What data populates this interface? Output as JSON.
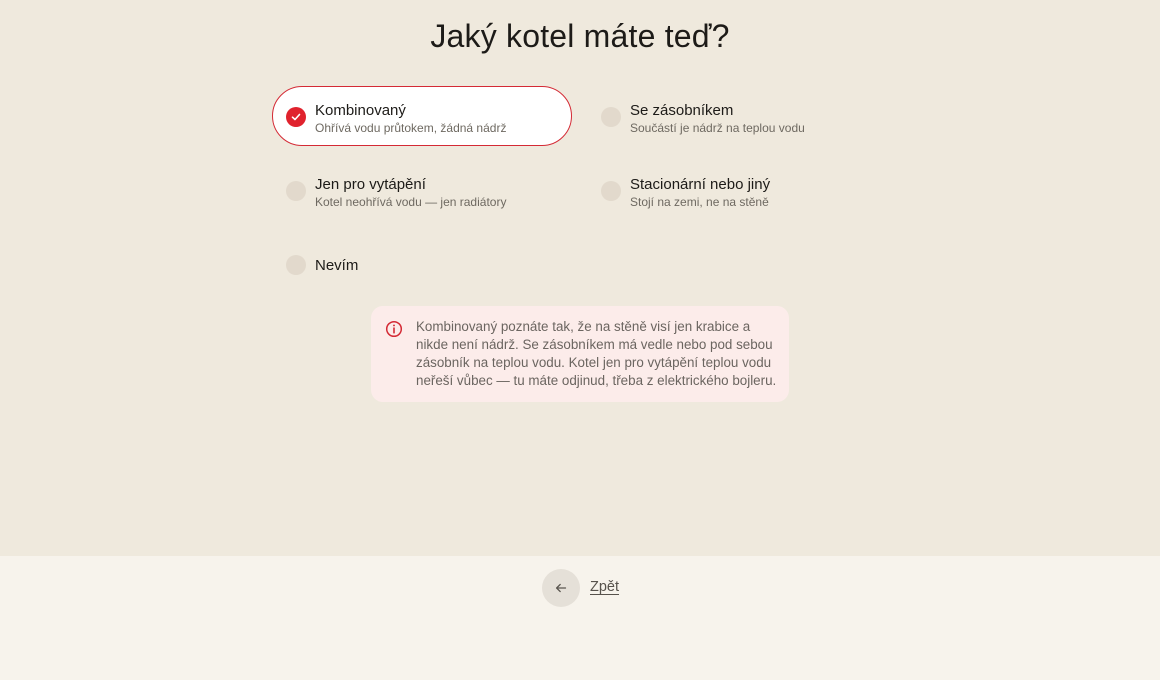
{
  "page": {
    "title": "Jaký kotel máte teď?"
  },
  "options": [
    {
      "label": "Kombinovaný",
      "description": "Ohřívá vodu průtokem, žádná nádrž",
      "selected": true
    },
    {
      "label": "Se zásobníkem",
      "description": "Součástí je nádrž na teplou vodu",
      "selected": false
    },
    {
      "label": "Jen pro vytápění",
      "description": "Kotel neohřívá vodu — jen radiátory",
      "selected": false
    },
    {
      "label": "Stacionární nebo jiný",
      "description": "Stojí na zemi, ne na stěně",
      "selected": false
    },
    {
      "label": "Nevím",
      "description": "",
      "selected": false
    }
  ],
  "info": {
    "icon": "info-circle-icon",
    "text": "Kombinovaný poznáte tak, že na stěně visí jen krabice a nikde není nádrž. Se zásobníkem má vedle nebo pod sebou zásobník na teplou vodu. Kotel jen pro vytápění teplou vodu neřeší vůbec — tu máte odjinud, třeba z elektrického bojleru."
  },
  "navigation": {
    "back_icon": "arrow-left-icon",
    "back_label": "Zpět"
  },
  "colors": {
    "accent": "#e0222d",
    "background": "#efe9dd",
    "footer_background": "#f7f3ec",
    "info_background": "#fcecea"
  }
}
